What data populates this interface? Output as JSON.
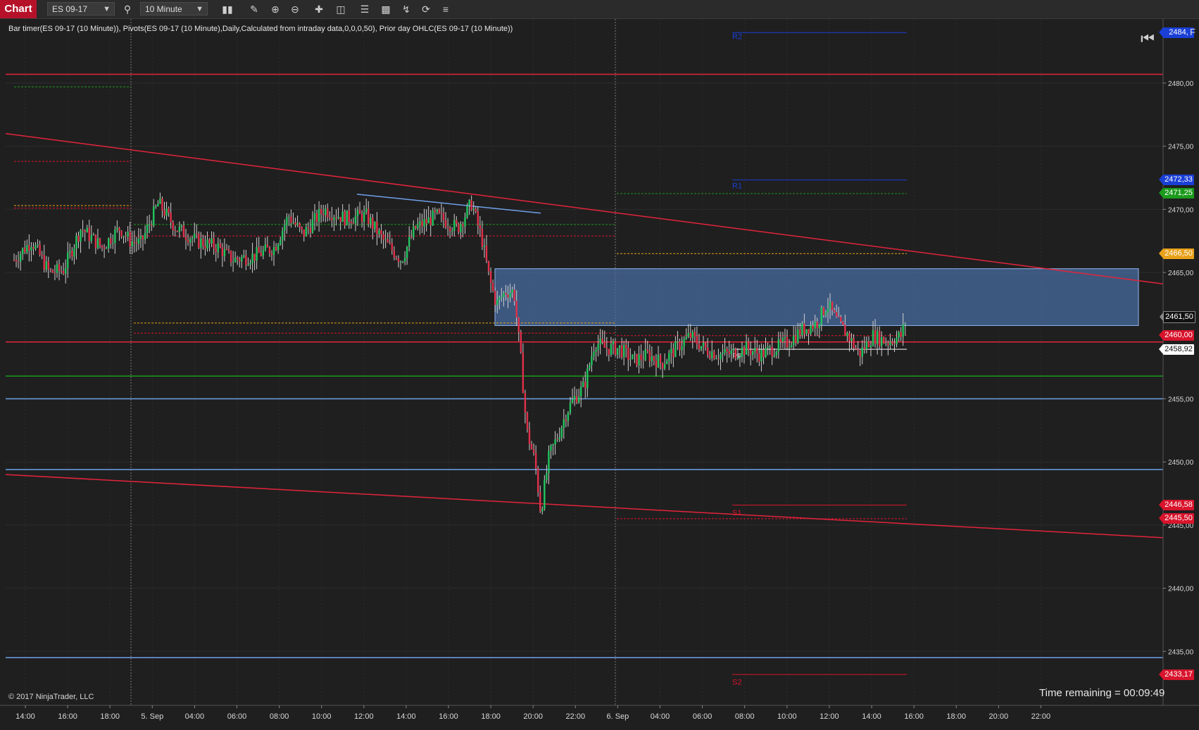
{
  "toolbar": {
    "chart_tab": "Chart",
    "instrument": "ES 09-17",
    "interval": "10 Minute",
    "icons": [
      "search-icon",
      "bars-type-icon",
      "pencil-icon",
      "zoom-in-icon",
      "zoom-out-icon",
      "crosshair-icon",
      "data-box-icon",
      "bar-spacing-icon",
      "chart-trader-icon",
      "strategies-icon",
      "reload-icon",
      "properties-icon"
    ]
  },
  "indicator_label": "Bar timer(ES 09-17 (10 Minute)), Pivots(ES 09-17 (10 Minute),Daily,Calculated from intraday data,0,0,0,50), Prior day OHLC(ES 09-17 (10 Minute))",
  "copyright": "© 2017 NinjaTrader, LLC",
  "time_remaining": "Time remaining = 00:09:49",
  "colors": {
    "background": "#1f1f1f",
    "up_candle": "#22c55e",
    "down_candle": "#e0304a",
    "price_line_red": "#e3243b",
    "horizontal_blue": "#6fa0e8",
    "zone_fill": "#4a6fa5"
  },
  "chart_data": {
    "type": "candlestick",
    "instrument": "ES 09-17",
    "interval": "10 Minute",
    "y_range": [
      2430,
      2484
    ],
    "y_ticks": [
      {
        "value": 2480,
        "label": "2480,00"
      },
      {
        "value": 2475,
        "label": "2475,00"
      },
      {
        "value": 2470,
        "label": "2470,00"
      },
      {
        "value": 2465,
        "label": "2465,00"
      },
      {
        "value": 2455,
        "label": "2455,00"
      },
      {
        "value": 2450,
        "label": "2450,00"
      },
      {
        "value": 2445,
        "label": "2445,00"
      },
      {
        "value": 2440,
        "label": "2440,00"
      },
      {
        "value": 2435,
        "label": "2435,00"
      }
    ],
    "x_ticks": [
      "14:00",
      "16:00",
      "18:00",
      "5. Sep",
      "04:00",
      "06:00",
      "08:00",
      "10:00",
      "12:00",
      "14:00",
      "16:00",
      "18:00",
      "20:00",
      "22:00",
      "6. Sep",
      "04:00",
      "06:00",
      "08:00",
      "10:00",
      "12:00",
      "14:00",
      "16:00",
      "18:00",
      "20:00",
      "22:00"
    ],
    "price_markers": [
      {
        "label": "2484,",
        "value": 2484.0,
        "color": "#1a3fd6",
        "suffix": "F"
      },
      {
        "label": "2472,33",
        "value": 2472.33,
        "color": "#1a3fd6"
      },
      {
        "label": "2471,25",
        "value": 2471.25,
        "color": "#1b9a1b"
      },
      {
        "label": "2466,50",
        "value": 2466.5,
        "color": "#e8a11a"
      },
      {
        "label": "2461,50",
        "value": 2461.5,
        "color": "#111111"
      },
      {
        "label": "2460,00",
        "value": 2460.0,
        "color": "#d8142c"
      },
      {
        "label": "2458,92",
        "value": 2458.92,
        "color": "#ffffff",
        "text_color": "#111111"
      },
      {
        "label": "2446,58",
        "value": 2446.58,
        "color": "#d8142c"
      },
      {
        "label": "2445,50",
        "value": 2445.5,
        "color": "#d8142c"
      },
      {
        "label": "2433,17",
        "value": 2433.17,
        "color": "#d8142c"
      }
    ],
    "pivot_labels": [
      "R2",
      "R1",
      "PP",
      "S1",
      "S2"
    ],
    "horizontal_lines": [
      {
        "value": 2480.7,
        "color": "#e3243b",
        "style": "solid"
      },
      {
        "value": 2459.5,
        "color": "#e3243b",
        "style": "solid"
      },
      {
        "value": 2456.8,
        "color": "#1b9a1b",
        "style": "solid"
      },
      {
        "value": 2455.0,
        "color": "#6fa0e8",
        "style": "solid"
      },
      {
        "value": 2449.4,
        "color": "#6fa0e8",
        "style": "solid"
      },
      {
        "value": 2434.5,
        "color": "#6fa0e8",
        "style": "solid"
      }
    ],
    "trend_lines": [
      {
        "from": [
          0,
          2476.0
        ],
        "to": [
          1,
          2464.1
        ],
        "color": "#e3243b"
      },
      {
        "from": [
          0,
          2449.0
        ],
        "to": [
          1,
          2444.0
        ],
        "color": "#e3243b"
      }
    ],
    "zone": {
      "y_top": 2465.3,
      "y_bottom": 2460.8,
      "color": "#4a6fa5"
    },
    "key_prices": {
      "last": 2461.5,
      "session_high": 2471.0,
      "session_low": 2445.5
    }
  }
}
